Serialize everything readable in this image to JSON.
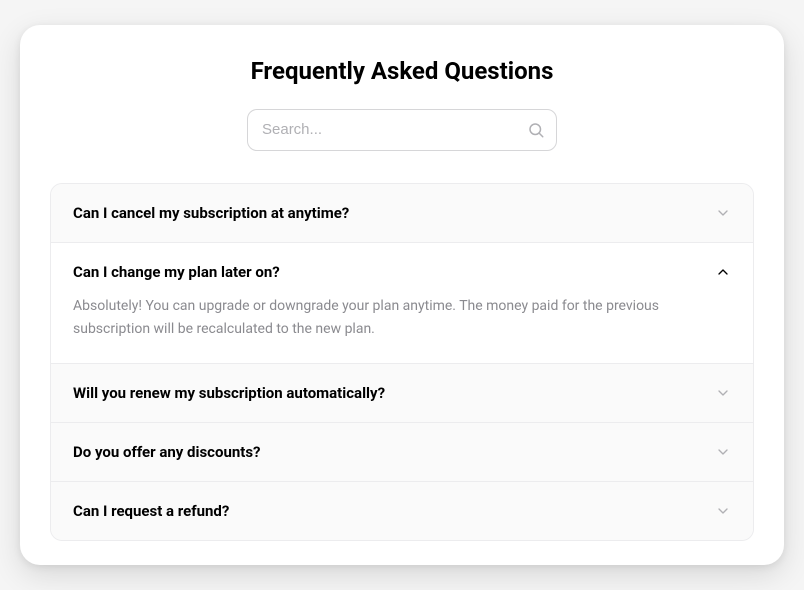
{
  "title": "Frequently Asked Questions",
  "search": {
    "placeholder": "Search..."
  },
  "faq": {
    "items": [
      {
        "question": "Can I cancel my subscription at anytime?",
        "expanded": false
      },
      {
        "question": "Can I change my plan later on?",
        "answer": "Absolutely! You can upgrade or downgrade your plan anytime. The money paid for the previous subscription will be recalculated to the new plan.",
        "expanded": true
      },
      {
        "question": "Will you renew my subscription automatically?",
        "expanded": false
      },
      {
        "question": "Do you offer any discounts?",
        "expanded": false
      },
      {
        "question": "Can I request a refund?",
        "expanded": false
      }
    ]
  }
}
